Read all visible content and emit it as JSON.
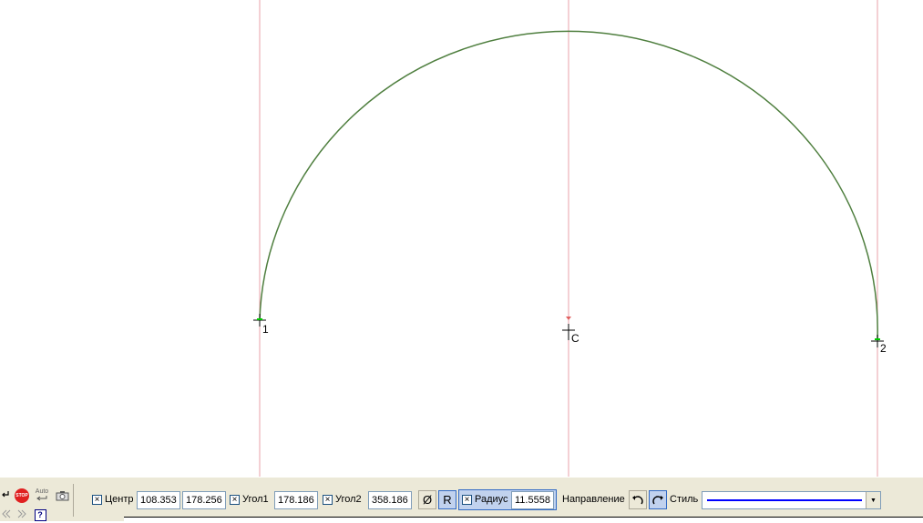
{
  "drawing": {
    "point_labels": {
      "start": "1",
      "center": "C",
      "end": "2"
    },
    "colors": {
      "arc": "#4f7f3f",
      "guide": "#e8a0a8",
      "marker_green": "#00cc00",
      "center_marker": "#e06060"
    }
  },
  "toolbar": {
    "stop_label": "STOP",
    "auto_label": "Auto",
    "help_label": "?",
    "center": {
      "checkbox": "×",
      "label": "Центр",
      "x_value": "108.353",
      "y_value": "178.256"
    },
    "angle1": {
      "checkbox": "×",
      "label": "Угол1",
      "value": "178.186"
    },
    "angle2": {
      "checkbox": "×",
      "label": "Угол2",
      "value": "358.186"
    },
    "diameter_button": "Ø",
    "radius_button": "R",
    "radius": {
      "checkbox": "×",
      "label": "Радиус",
      "value": "11.5558"
    },
    "direction": {
      "label": "Направление",
      "ccw_icon": "rotate-ccw-icon",
      "cw_icon": "rotate-cw-icon"
    },
    "style": {
      "label": "Стиль",
      "line_color": "#0000ff"
    }
  }
}
